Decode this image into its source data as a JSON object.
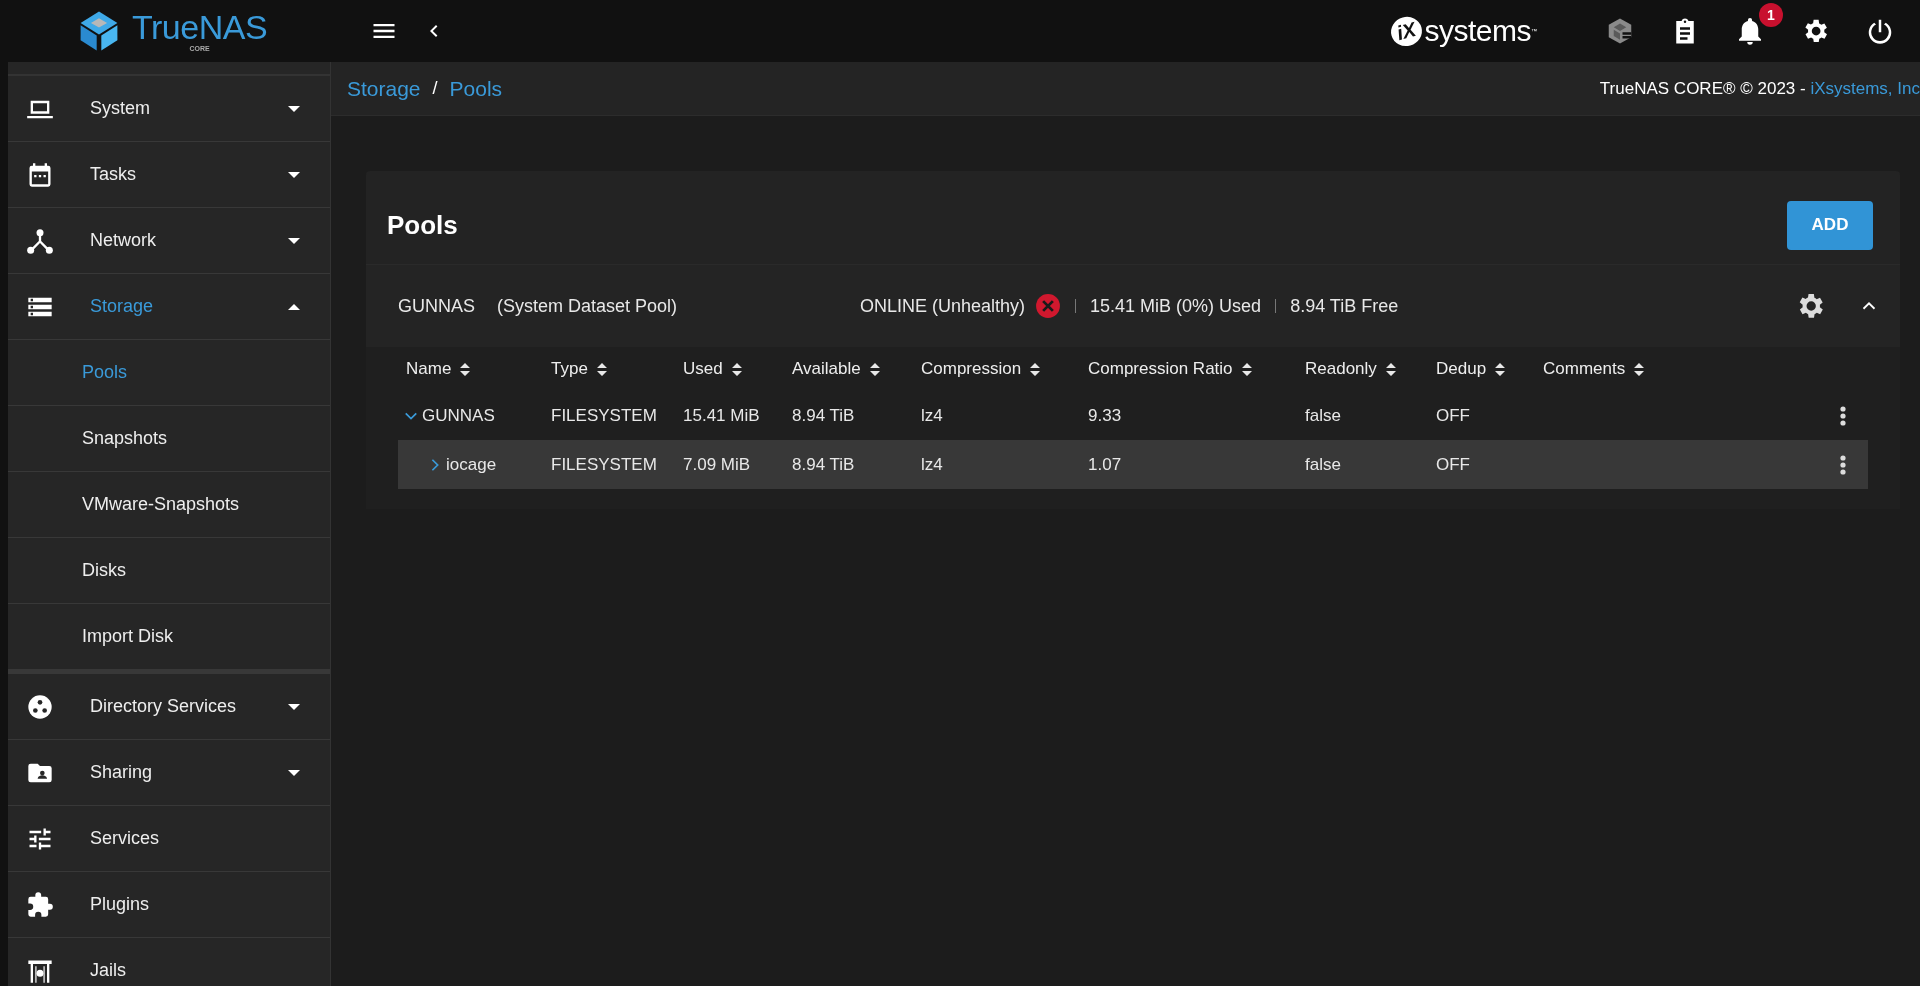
{
  "topbar": {
    "logo": {
      "name": "TrueNAS",
      "edition": "CORE"
    },
    "vendor_logo": {
      "mark": "iX",
      "name": "systems",
      "trademark": "™"
    },
    "notifications": {
      "count": "1"
    }
  },
  "sidebar": {
    "items": [
      {
        "label": "System",
        "kind": "group",
        "expanded": false,
        "selected": false
      },
      {
        "label": "Tasks",
        "kind": "group",
        "expanded": false,
        "selected": false
      },
      {
        "label": "Network",
        "kind": "group",
        "expanded": false,
        "selected": false
      },
      {
        "label": "Storage",
        "kind": "group",
        "expanded": true,
        "selected": true,
        "children": [
          {
            "label": "Pools",
            "selected": true
          },
          {
            "label": "Snapshots",
            "selected": false
          },
          {
            "label": "VMware-Snapshots",
            "selected": false
          },
          {
            "label": "Disks",
            "selected": false
          },
          {
            "label": "Import Disk",
            "selected": false
          }
        ]
      },
      {
        "label": "Directory Services",
        "kind": "group",
        "expanded": false,
        "selected": false
      },
      {
        "label": "Sharing",
        "kind": "group",
        "expanded": false,
        "selected": false
      },
      {
        "label": "Services",
        "kind": "link",
        "selected": false
      },
      {
        "label": "Plugins",
        "kind": "link",
        "selected": false
      },
      {
        "label": "Jails",
        "kind": "link",
        "selected": false
      }
    ]
  },
  "breadcrumb": {
    "items": [
      "Storage",
      "Pools"
    ],
    "separator": "/"
  },
  "copyright": {
    "text": "TrueNAS CORE® © 2023 - ",
    "link": "iXsystems, Inc"
  },
  "card": {
    "title": "Pools",
    "add_button": "ADD",
    "pool": {
      "name": "GUNNAS",
      "role": "(System Dataset Pool)",
      "status": "ONLINE (Unhealthy)",
      "healthy": false,
      "used": "15.41 MiB (0%) Used",
      "free": "8.94 TiB Free",
      "expanded": true
    },
    "table": {
      "columns": [
        "Name",
        "Type",
        "Used",
        "Available",
        "Compression",
        "Compression Ratio",
        "Readonly",
        "Dedup",
        "Comments"
      ],
      "rows": [
        {
          "cells": [
            "GUNNAS",
            "FILESYSTEM",
            "15.41 MiB",
            "8.94 TiB",
            "lz4",
            "9.33",
            "false",
            "OFF"
          ],
          "expanded": true,
          "selected": false,
          "children": [
            {
              "cells": [
                "iocage",
                "FILESYSTEM",
                "7.09 MiB",
                "8.94 TiB",
                "lz4",
                "1.07",
                "false",
                "OFF"
              ],
              "expanded": false,
              "selected": true
            }
          ]
        }
      ]
    }
  }
}
